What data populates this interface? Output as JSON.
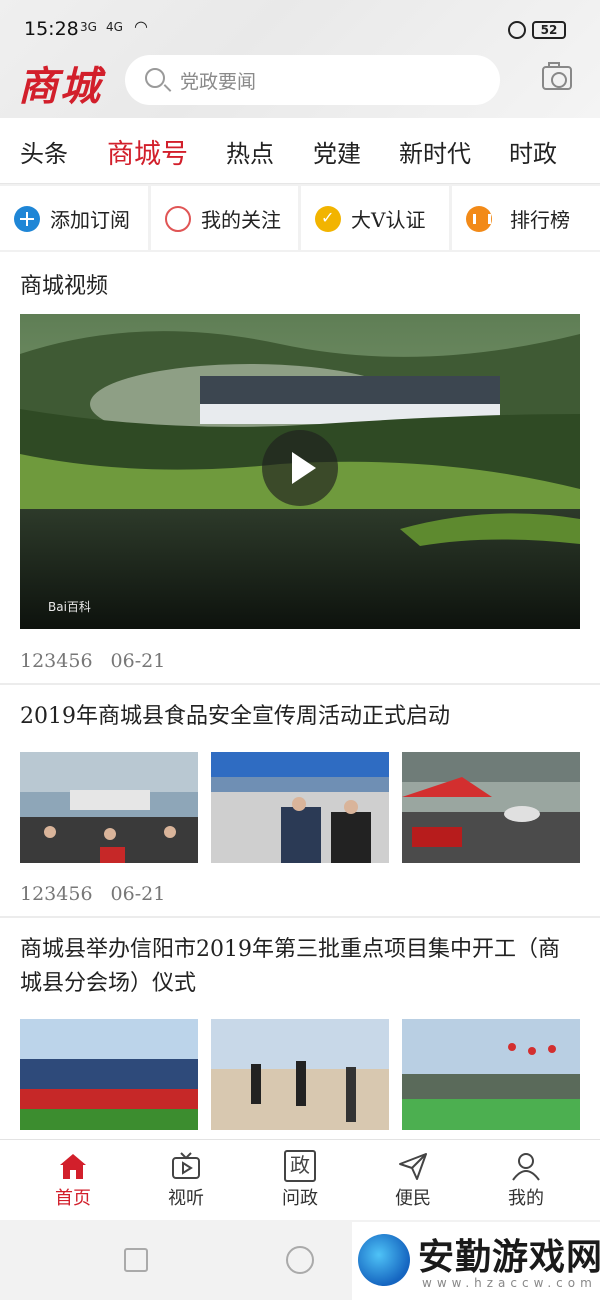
{
  "status_bar": {
    "time": "15:28",
    "net1": "3G",
    "net2": "4G",
    "battery": "52"
  },
  "header": {
    "logo": "商城",
    "search_placeholder": "党政要闻"
  },
  "tabs": [
    "头条",
    "商城号",
    "热点",
    "党建",
    "新时代",
    "时政"
  ],
  "active_tab": "商城号",
  "quick_actions": [
    "添加订阅",
    "我的关注",
    "大V认证",
    "排行榜"
  ],
  "video_section": {
    "title": "商城视频",
    "watermark": "Bai百科",
    "views": "123456",
    "date": "06-21"
  },
  "articles": [
    {
      "title": "2019年商城县食品安全宣传周活动正式启动",
      "views": "123456",
      "date": "06-21"
    },
    {
      "title": "商城县举办信阳市2019年第三批重点项目集中开工（商城县分会场）仪式"
    }
  ],
  "bottom_nav": [
    {
      "label": "首页",
      "icon": "home-icon"
    },
    {
      "label": "视听",
      "icon": "tv-icon"
    },
    {
      "label": "问政",
      "icon": "zheng-icon",
      "glyph": "政"
    },
    {
      "label": "便民",
      "icon": "send-icon"
    },
    {
      "label": "我的",
      "icon": "user-icon"
    }
  ],
  "watermark": {
    "text": "安勤游戏网",
    "url": "www.hzaccw.com"
  },
  "colors": {
    "accent": "#d21f2b",
    "blue": "#1f86d6",
    "gold": "#f2b400",
    "orange": "#f28a18"
  }
}
